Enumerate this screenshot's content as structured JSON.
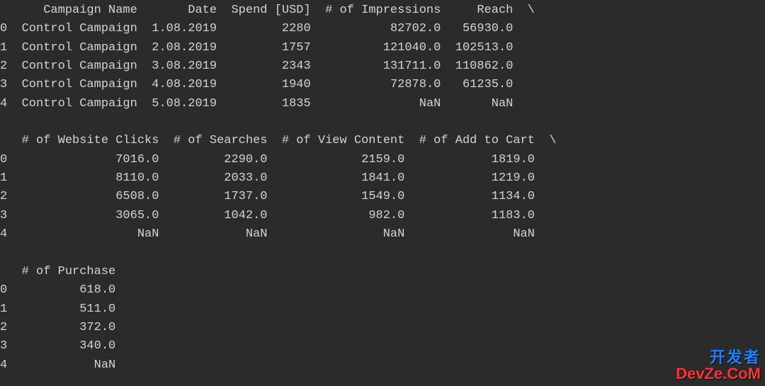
{
  "block1": {
    "headers": [
      "",
      "Campaign Name",
      "Date",
      "Spend [USD]",
      "# of Impressions",
      "Reach",
      "\\"
    ],
    "rows": [
      {
        "idx": "0",
        "campaign": "Control Campaign",
        "date": "1.08.2019",
        "spend": "2280",
        "impressions": "82702.0",
        "reach": "56930.0"
      },
      {
        "idx": "1",
        "campaign": "Control Campaign",
        "date": "2.08.2019",
        "spend": "1757",
        "impressions": "121040.0",
        "reach": "102513.0"
      },
      {
        "idx": "2",
        "campaign": "Control Campaign",
        "date": "3.08.2019",
        "spend": "2343",
        "impressions": "131711.0",
        "reach": "110862.0"
      },
      {
        "idx": "3",
        "campaign": "Control Campaign",
        "date": "4.08.2019",
        "spend": "1940",
        "impressions": "72878.0",
        "reach": "61235.0"
      },
      {
        "idx": "4",
        "campaign": "Control Campaign",
        "date": "5.08.2019",
        "spend": "1835",
        "impressions": "NaN",
        "reach": "NaN"
      }
    ]
  },
  "block2": {
    "headers": [
      "",
      "# of Website Clicks",
      "# of Searches",
      "# of View Content",
      "# of Add to Cart",
      "\\"
    ],
    "rows": [
      {
        "idx": "0",
        "clicks": "7016.0",
        "searches": "2290.0",
        "viewcontent": "2159.0",
        "addtocart": "1819.0"
      },
      {
        "idx": "1",
        "clicks": "8110.0",
        "searches": "2033.0",
        "viewcontent": "1841.0",
        "addtocart": "1219.0"
      },
      {
        "idx": "2",
        "clicks": "6508.0",
        "searches": "1737.0",
        "viewcontent": "1549.0",
        "addtocart": "1134.0"
      },
      {
        "idx": "3",
        "clicks": "3065.0",
        "searches": "1042.0",
        "viewcontent": "982.0",
        "addtocart": "1183.0"
      },
      {
        "idx": "4",
        "clicks": "NaN",
        "searches": "NaN",
        "viewcontent": "NaN",
        "addtocart": "NaN"
      }
    ]
  },
  "block3": {
    "headers": [
      "",
      "# of Purchase"
    ],
    "rows": [
      {
        "idx": "0",
        "purchase": "618.0"
      },
      {
        "idx": "1",
        "purchase": "511.0"
      },
      {
        "idx": "2",
        "purchase": "372.0"
      },
      {
        "idx": "3",
        "purchase": "340.0"
      },
      {
        "idx": "4",
        "purchase": "NaN"
      }
    ]
  },
  "watermark": {
    "top": "开发者",
    "bottom": "DevZe.CoM"
  }
}
